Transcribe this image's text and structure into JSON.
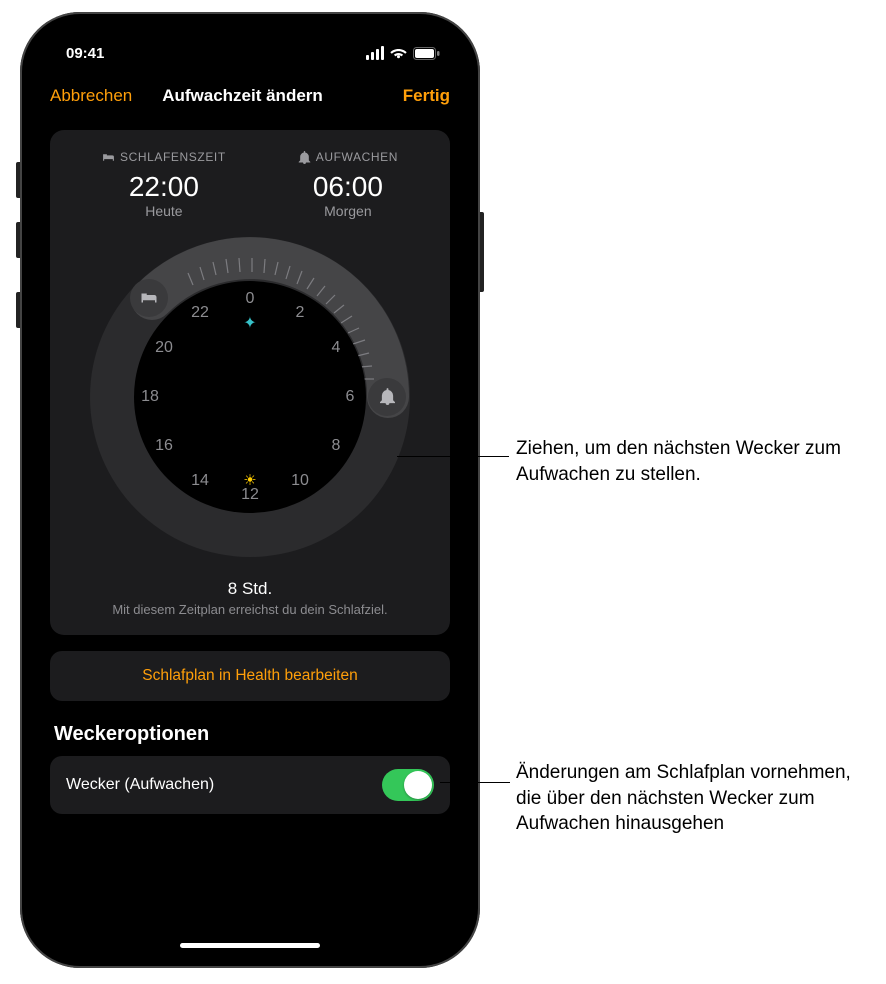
{
  "status": {
    "time": "09:41"
  },
  "nav": {
    "cancel": "Abbrechen",
    "title": "Aufwachzeit ändern",
    "done": "Fertig"
  },
  "sleep": {
    "bed_label": "SCHLAFENSZEIT",
    "bed_time": "22:00",
    "bed_day": "Heute",
    "wake_label": "AUFWACHEN",
    "wake_time": "06:00",
    "wake_day": "Morgen"
  },
  "clock_hours": [
    "0",
    "2",
    "4",
    "6",
    "8",
    "10",
    "12",
    "14",
    "16",
    "18",
    "20",
    "22"
  ],
  "duration": {
    "hours": "8 Std.",
    "message": "Mit diesem Zeitplan erreichst du dein Schlafziel."
  },
  "health_button": "Schlafplan in Health bearbeiten",
  "options": {
    "header": "Weckeroptionen",
    "wake_alarm_label": "Wecker (Aufwachen)",
    "wake_alarm_on": true
  },
  "callouts": {
    "drag": "Ziehen, um den nächsten Wecker zum Aufwachen zu stellen.",
    "edit": "Änderungen am Schlafplan vornehmen, die über den nächsten Wecker zum Aufwachen hinausgehen"
  }
}
